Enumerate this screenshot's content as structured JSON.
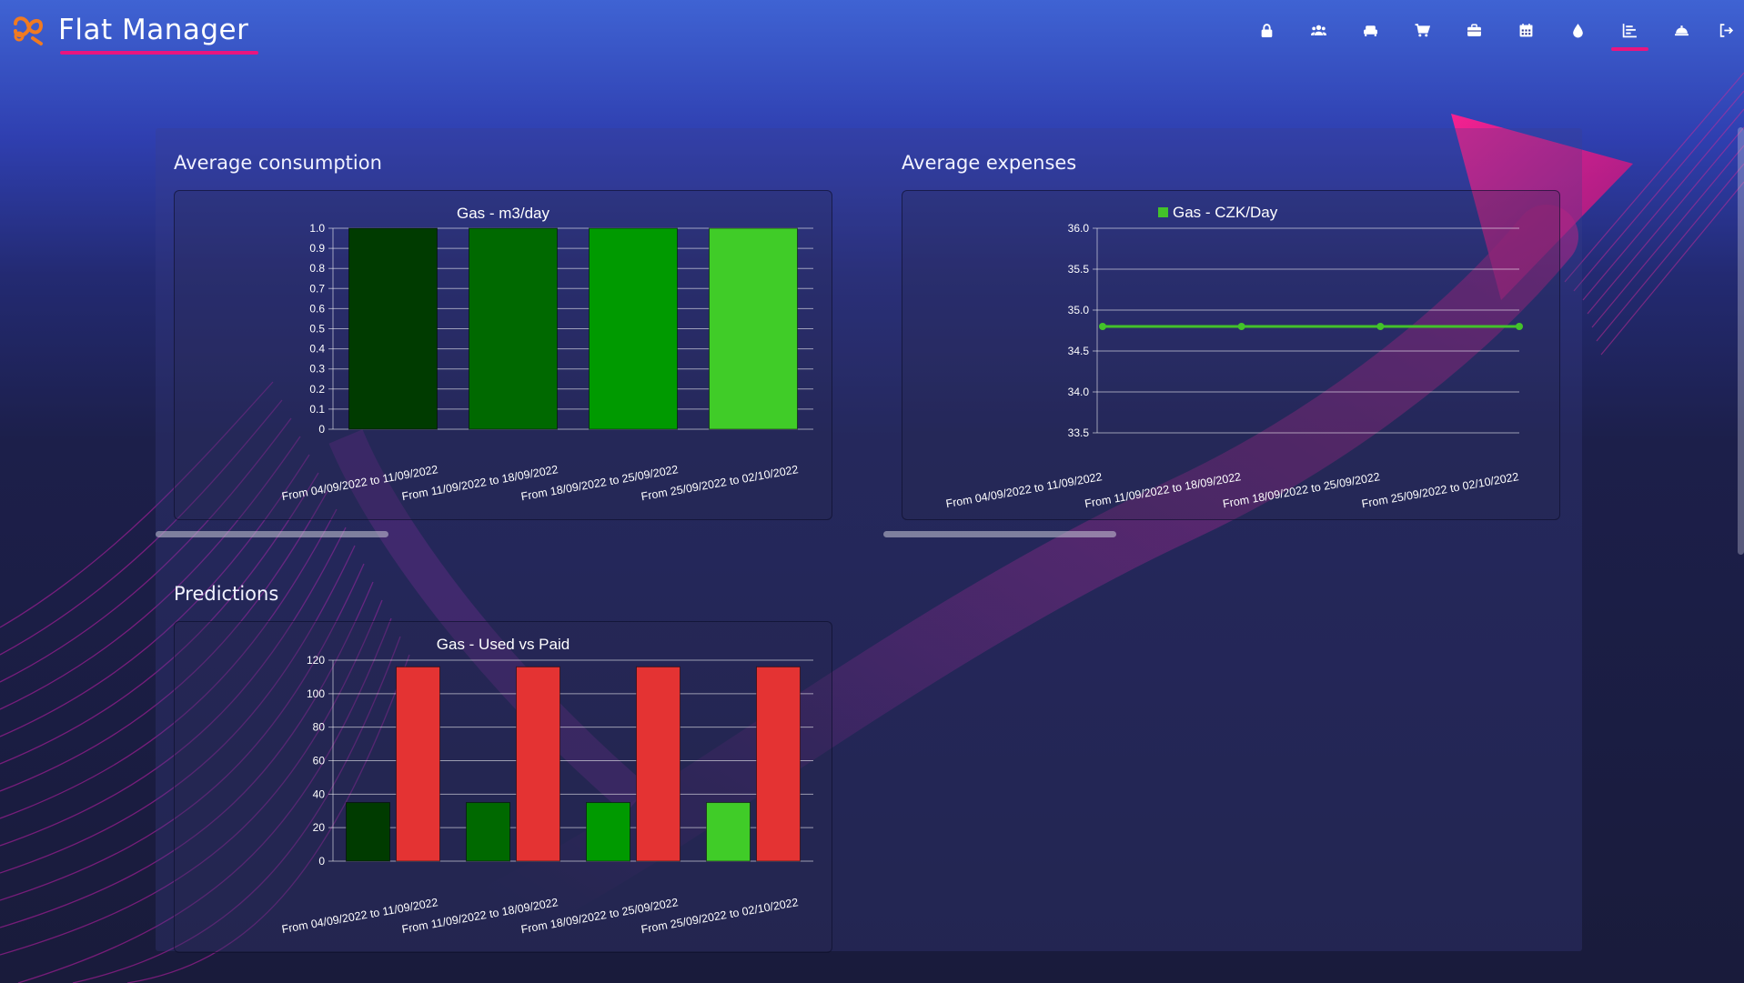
{
  "app": {
    "title": "Flat Manager"
  },
  "nav": {
    "items": [
      {
        "name": "lock-icon",
        "active": false
      },
      {
        "name": "users-icon",
        "active": false
      },
      {
        "name": "sofa-icon",
        "active": false
      },
      {
        "name": "cart-icon",
        "active": false
      },
      {
        "name": "briefcase-icon",
        "active": false
      },
      {
        "name": "calendar-icon",
        "active": false
      },
      {
        "name": "drop-icon",
        "active": false
      },
      {
        "name": "chart-icon",
        "active": true
      },
      {
        "name": "bell-icon",
        "active": false
      },
      {
        "name": "logout-icon",
        "active": false
      }
    ]
  },
  "sections": {
    "consumption_title": "Average consumption",
    "expenses_title": "Average expenses",
    "predictions_title": "Predictions"
  },
  "colors": {
    "accent": "#e9157f",
    "green_dark": "#003b00",
    "green_mid": "#006900",
    "green": "#009a00",
    "green_light": "#40cc28",
    "red": "#e43333",
    "line_green": "#43c22a"
  },
  "chart_data": [
    {
      "type": "bar",
      "title": "Gas - m3/day",
      "categories": [
        "From 04/09/2022 to 11/09/2022",
        "From 11/09/2022 to 18/09/2022",
        "From 18/09/2022 to 25/09/2022",
        "From 25/09/2022 to 02/10/2022"
      ],
      "values": [
        1,
        1,
        1,
        1
      ],
      "ylim": [
        0,
        1
      ],
      "yticks": [
        "0",
        "0.1",
        "0.2",
        "0.3",
        "0.4",
        "0.5",
        "0.6",
        "0.7",
        "0.8",
        "0.9",
        "1.0"
      ],
      "bar_colors": [
        "#003b00",
        "#006900",
        "#009a00",
        "#40cc28"
      ],
      "grid": true
    },
    {
      "type": "line",
      "title": "",
      "categories": [
        "From 04/09/2022 to 11/09/2022",
        "From 11/09/2022 to 18/09/2022",
        "From 18/09/2022 to 25/09/2022",
        "From 25/09/2022 to 02/10/2022"
      ],
      "series": [
        {
          "name": "Gas - CZK/Day",
          "values": [
            34.8,
            34.8,
            34.8,
            34.8
          ]
        }
      ],
      "ylim": [
        33.5,
        36.0
      ],
      "yticks": [
        "33.5",
        "34.0",
        "34.5",
        "35.0",
        "35.5",
        "36.0"
      ],
      "legend": "top",
      "grid": true
    },
    {
      "type": "bar",
      "title": "Gas - Used vs  Paid",
      "categories": [
        "From 04/09/2022 to 11/09/2022",
        "From 11/09/2022 to 18/09/2022",
        "From 18/09/2022 to 25/09/2022",
        "From 25/09/2022 to 02/10/2022"
      ],
      "series": [
        {
          "values": [
            35,
            35,
            35,
            35
          ],
          "colors": [
            "#003b00",
            "#006900",
            "#009a00",
            "#40cc28"
          ]
        },
        {
          "values": [
            116,
            116,
            116,
            116
          ],
          "colors": [
            "#e43333",
            "#e43333",
            "#e43333",
            "#e43333"
          ]
        }
      ],
      "ylim": [
        0,
        120
      ],
      "yticks": [
        "0",
        "20",
        "40",
        "60",
        "80",
        "100",
        "120"
      ],
      "grid": true
    }
  ]
}
